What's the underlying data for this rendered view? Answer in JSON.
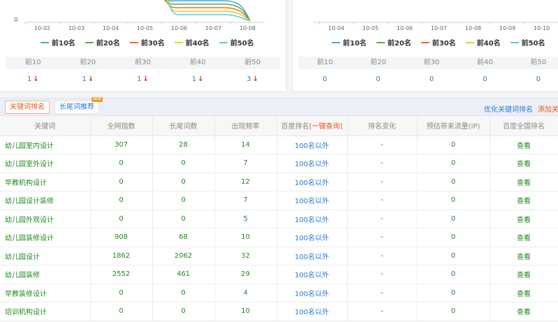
{
  "left_chart": {
    "y_zero_label": "0",
    "x_ticks": [
      "10-02",
      "10-03",
      "10-04",
      "10-05",
      "10-06",
      "10-07",
      "10-08"
    ]
  },
  "right_chart": {
    "x_ticks": [
      "10-04",
      "10-05",
      "10-06",
      "10-07",
      "10-08",
      "10-09",
      "10-10"
    ]
  },
  "legend": [
    {
      "label": "前10名",
      "color": "#3fa7e0"
    },
    {
      "label": "前20名",
      "color": "#5aa845"
    },
    {
      "label": "前30名",
      "color": "#ef6a2c"
    },
    {
      "label": "前40名",
      "color": "#e8cf2a"
    },
    {
      "label": "前50名",
      "color": "#5ccbe8"
    }
  ],
  "stats_headers": [
    "前10",
    "前20",
    "前30",
    "前40",
    "前50"
  ],
  "left_stats": [
    "1",
    "1",
    "1",
    "1",
    "3"
  ],
  "right_stats": [
    "0",
    "0",
    "0",
    "0",
    "0"
  ],
  "tabs": {
    "rank": "关键词排名",
    "long": "长尾词推荐",
    "badge": "NEW"
  },
  "links": {
    "optimize": "优化关键词排名",
    "add": "添加关键词"
  },
  "table": {
    "headers": [
      "关键词",
      "全网指数",
      "长尾词数",
      "出现频率",
      "百度排名",
      "排名变化",
      "预估带来流量(IP)",
      "百度全国排名"
    ],
    "rank_query": "[一键查询]",
    "rows": [
      [
        "幼儿园室内设计",
        "307",
        "28",
        "14",
        "100名以外",
        "-",
        "0",
        "查看"
      ],
      [
        "幼儿园室外设计",
        "0",
        "0",
        "7",
        "100名以外",
        "-",
        "0",
        "查看"
      ],
      [
        "早教机构设计",
        "0",
        "0",
        "12",
        "100名以外",
        "-",
        "0",
        "查看"
      ],
      [
        "幼儿园设计装修",
        "0",
        "0",
        "7",
        "100名以外",
        "-",
        "0",
        "查看"
      ],
      [
        "幼儿园外观设计",
        "0",
        "0",
        "5",
        "100名以外",
        "-",
        "0",
        "查看"
      ],
      [
        "幼儿园装修设计",
        "908",
        "68",
        "10",
        "100名以外",
        "-",
        "0",
        "查看"
      ],
      [
        "幼儿园设计",
        "1862",
        "2062",
        "32",
        "100名以外",
        "-",
        "0",
        "查看"
      ],
      [
        "幼儿园装修",
        "2552",
        "461",
        "29",
        "100名以外",
        "-",
        "0",
        "查看"
      ],
      [
        "早教装修设计",
        "0",
        "0",
        "4",
        "100名以外",
        "-",
        "0",
        "查看"
      ],
      [
        "培训机构设计",
        "0",
        "0",
        "10",
        "100名以外",
        "-",
        "0",
        "查看"
      ]
    ]
  }
}
